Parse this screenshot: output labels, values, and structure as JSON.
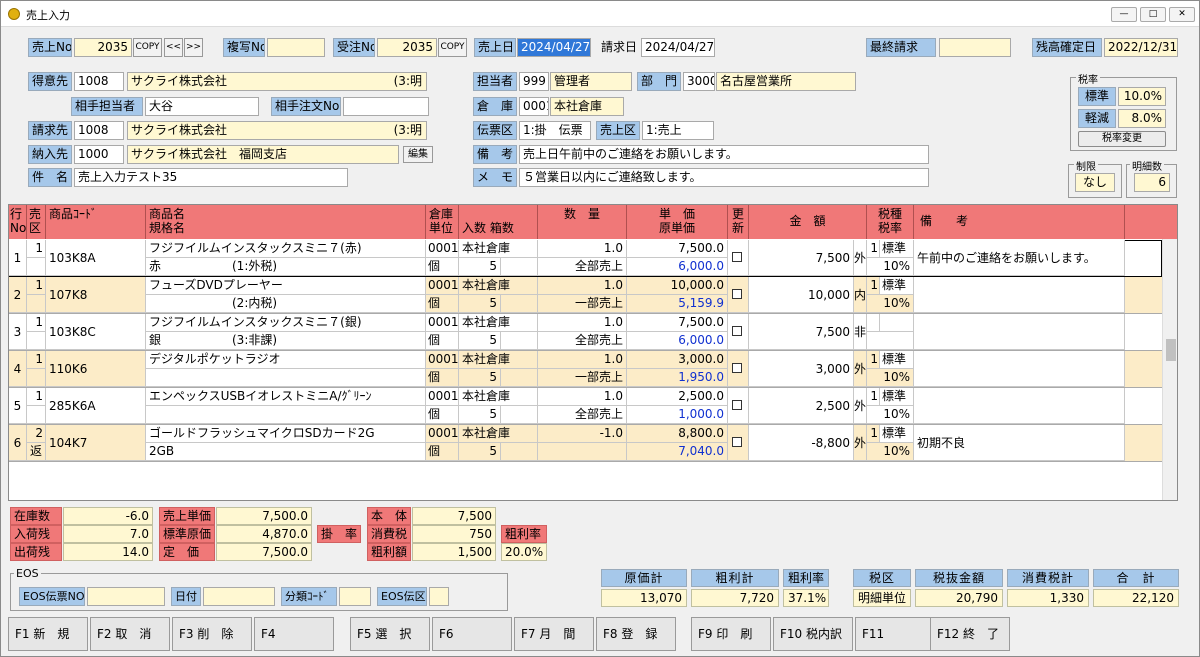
{
  "window": {
    "title": "売上入力",
    "min": "—",
    "max": "□",
    "close": "✕"
  },
  "top": {
    "sales_no_label": "売上No",
    "sales_no": "2035",
    "copy": "COPY",
    "prev": "<<",
    "next": ">>",
    "copy_no_label": "複写No",
    "copy_no": "",
    "order_no_label": "受注No",
    "order_no": "2035",
    "copy2": "COPY",
    "sales_date_label": "売上日",
    "sales_date": "2024/04/27",
    "bill_date_label": "請求日",
    "bill_date": "2024/04/27",
    "last_bill_label": "最終請求",
    "last_bill": "",
    "balance_date_label": "残高確定日",
    "balance_date": "2022/12/31"
  },
  "customer": {
    "tokuisaki_label": "得意先",
    "tokuisaki_code": "1008",
    "tokuisaki_name": "サクライ株式会社",
    "tokuisaki_extra": "(3:明",
    "contact_label": "相手担当者",
    "contact": "大谷",
    "po_label": "相手注文No",
    "po": "",
    "seikyu_label": "請求先",
    "seikyu_code": "1008",
    "seikyu_name": "サクライ株式会社",
    "seikyu_extra": "(3:明",
    "nonyu_label": "納入先",
    "nonyu_code": "1000",
    "nonyu_name": "サクライ株式会社　福岡支店",
    "edit": "編集",
    "subject_label": "件　名",
    "subject": "売上入力テスト35"
  },
  "staff": {
    "tanto_label": "担当者",
    "tanto_code": "999",
    "tanto_name": "管理者",
    "bumon_label": "部　門",
    "bumon_code": "3000",
    "bumon_name": "名古屋営業所",
    "soko_label": "倉　庫",
    "soko_code": "0001",
    "soko_name": "本社倉庫",
    "denpyo_label": "伝票区",
    "denpyo": "1:掛　伝票",
    "uriage_kubun_label": "売上区",
    "uriage_kubun": "1:売上",
    "biko_label": "備　考",
    "biko": "売上日午前中のご連絡をお願いします。",
    "memo_label": "メ　モ",
    "memo": "５営業日以内にご連絡致します。"
  },
  "tax_box": {
    "title": "税率",
    "standard_label": "標準",
    "standard": "10.0%",
    "reduced_label": "軽減",
    "reduced": "8.0%",
    "change_button": "税率変更",
    "limit_title": "制限",
    "limit": "なし",
    "lines_title": "明細数",
    "lines": "6"
  },
  "grid": {
    "headers": {
      "line": "行\nNo",
      "kubun": "売\n区",
      "code": "商品ｺｰﾄﾞ",
      "name": "商品名\n規格名",
      "soko": "倉庫\n単位",
      "qty": "入数 箱数",
      "suryo": "数　量",
      "tanka": "単　価\n原単価",
      "update": "更\n新",
      "amount": "金　額",
      "tax": "税種\n税率",
      "biko": "備　　考"
    },
    "rows": [
      {
        "no": "1",
        "kubun": "1",
        "henpin": "",
        "code": "103K8A",
        "name": "フジフイルムインスタックスミニ７(赤)",
        "spec": "赤",
        "tax_kind_text": "(1:外税)",
        "soko": "0001",
        "soko_name": "本社倉庫",
        "unit": "個",
        "irisu": "5",
        "qty": "1.0",
        "ship": "全部売上",
        "price": "7,500.0",
        "cost": "6,000.0",
        "amount": "7,500",
        "taxmode": "外",
        "taxno": "1",
        "taxtype": "標準",
        "rate": "10%",
        "biko": "午前中のご連絡をお願いします。",
        "alt": false
      },
      {
        "no": "2",
        "kubun": "1",
        "henpin": "",
        "code": "107K8",
        "name": "フューズDVDプレーヤー",
        "spec": "",
        "tax_kind_text": "(2:内税)",
        "soko": "0001",
        "soko_name": "本社倉庫",
        "unit": "個",
        "irisu": "5",
        "qty": "1.0",
        "ship": "一部売上",
        "price": "10,000.0",
        "cost": "5,159.9",
        "amount": "10,000",
        "taxmode": "内",
        "taxno": "1",
        "taxtype": "標準",
        "rate": "10%",
        "biko": "",
        "alt": true
      },
      {
        "no": "3",
        "kubun": "1",
        "henpin": "",
        "code": "103K8C",
        "name": "フジフイルムインスタックスミニ７(銀)",
        "spec": "銀",
        "tax_kind_text": "(3:非課)",
        "soko": "0001",
        "soko_name": "本社倉庫",
        "unit": "個",
        "irisu": "5",
        "qty": "1.0",
        "ship": "全部売上",
        "price": "7,500.0",
        "cost": "6,000.0",
        "amount": "7,500",
        "taxmode": "非",
        "taxno": "",
        "taxtype": "",
        "rate": "",
        "biko": "",
        "alt": false
      },
      {
        "no": "4",
        "kubun": "1",
        "henpin": "",
        "code": "110K6",
        "name": "デジタルポケットラジオ",
        "spec": "",
        "tax_kind_text": "",
        "soko": "0001",
        "soko_name": "本社倉庫",
        "unit": "個",
        "irisu": "5",
        "qty": "1.0",
        "ship": "一部売上",
        "price": "3,000.0",
        "cost": "1,950.0",
        "amount": "3,000",
        "taxmode": "外",
        "taxno": "1",
        "taxtype": "標準",
        "rate": "10%",
        "biko": "",
        "alt": true
      },
      {
        "no": "5",
        "kubun": "1",
        "henpin": "",
        "code": "285K6A",
        "name": "エンペックスUSBイオレストミニA/ｸﾞﾘｰﾝ",
        "spec": "",
        "tax_kind_text": "",
        "soko": "0001",
        "soko_name": "本社倉庫",
        "unit": "個",
        "irisu": "5",
        "qty": "1.0",
        "ship": "全部売上",
        "price": "2,500.0",
        "cost": "1,000.0",
        "amount": "2,500",
        "taxmode": "外",
        "taxno": "1",
        "taxtype": "標準",
        "rate": "10%",
        "biko": "",
        "alt": false
      },
      {
        "no": "6",
        "kubun": "2",
        "henpin": "返",
        "code": "104K7",
        "name": "ゴールドフラッシュマイクロSDカード2G",
        "spec": "2GB",
        "tax_kind_text": "",
        "soko": "0001",
        "soko_name": "本社倉庫",
        "unit": "個",
        "irisu": "5",
        "qty": "-1.0",
        "ship": "",
        "price": "8,800.0",
        "cost": "7,040.0",
        "amount": "-8,800",
        "taxmode": "外",
        "taxno": "1",
        "taxtype": "標準",
        "rate": "10%",
        "biko": "初期不良",
        "alt": true
      }
    ]
  },
  "stock": {
    "zaiko_label": "在庫数",
    "zaiko": "-6.0",
    "nyuka_label": "入荷残",
    "nyuka": "7.0",
    "shukka_label": "出荷残",
    "shukka": "14.0",
    "sales_price_label": "売上単価",
    "sales_price": "7,500.0",
    "std_cost_label": "標準原価",
    "std_cost": "4,870.0",
    "list_price_label": "定　価",
    "list_price": "7,500.0",
    "kakeritsu_label": "掛　率",
    "hontai_label": "本　体",
    "hontai": "7,500",
    "tax_label": "消費税",
    "tax": "750",
    "profit_label": "粗利額",
    "profit": "1,500",
    "profit_rate_label": "粗利率",
    "profit_rate": "20.0%"
  },
  "eos": {
    "title": "EOS",
    "denpyo_label": "EOS伝票NO",
    "date_label": "日付",
    "bunrui_label": "分類ｺｰﾄﾞ",
    "denku_label": "EOS伝区"
  },
  "totals": {
    "cost_label": "原価計",
    "cost": "13,070",
    "profit_label": "粗利計",
    "profit": "7,720",
    "rate_label": "粗利率",
    "rate": "37.1%",
    "taxku_label": "税区",
    "taxku": "明細単位",
    "nuki_label": "税抜金額",
    "nuki": "20,790",
    "tax_label": "消費税計",
    "tax": "1,330",
    "total_label": "合　計",
    "total": "22,120"
  },
  "fkeys": [
    "F1 新　規",
    "F2 取　消",
    "F3 削　除",
    "F4",
    "F5 選　択",
    "F6",
    "F7 月　間",
    "F8 登　録",
    "F9 印　刷",
    "F10 税内訳",
    "F11",
    "F12 終　了"
  ]
}
